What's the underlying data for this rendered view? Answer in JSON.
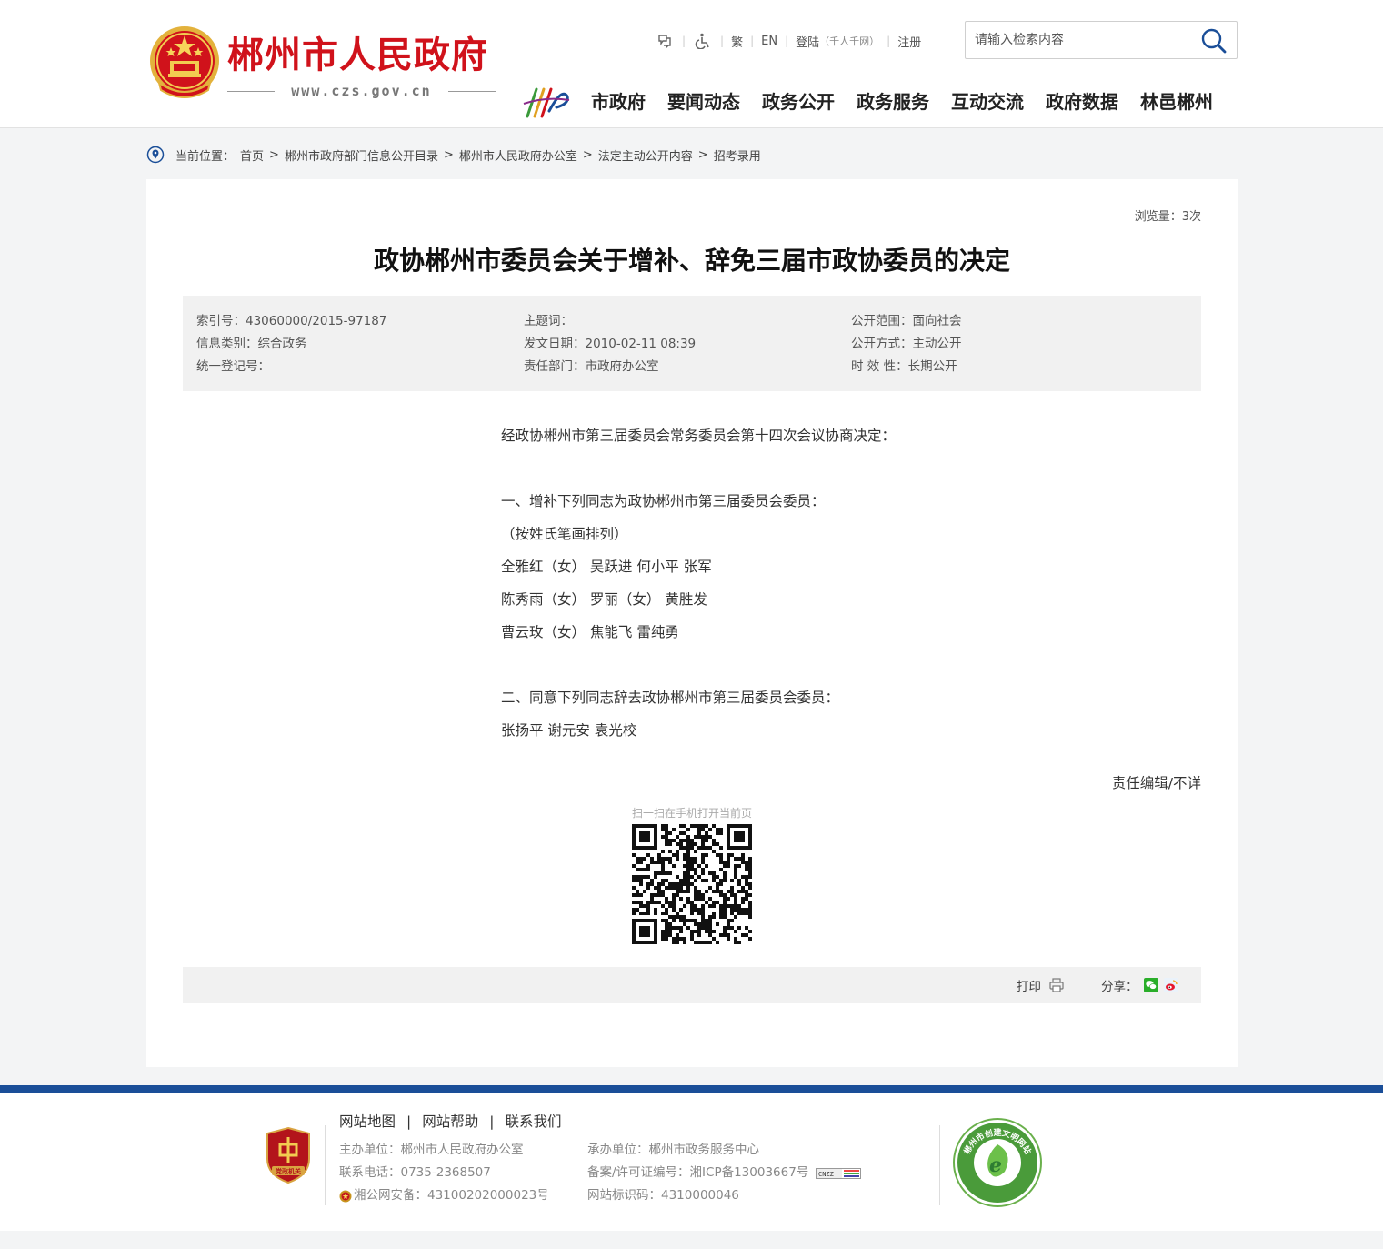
{
  "header": {
    "site_title": "郴州市人民政府",
    "site_url": "www.czs.gov.cn",
    "toplinks": {
      "traditional": "繁",
      "english": "EN",
      "login": "登陆",
      "login_note": "（千人千网）",
      "register": "注册"
    },
    "search_placeholder": "请输入检索内容",
    "nav": [
      "市政府",
      "要闻动态",
      "政务公开",
      "政务服务",
      "互动交流",
      "政府数据",
      "林邑郴州"
    ]
  },
  "breadcrumb": {
    "label": "当前位置：",
    "items": [
      "首页",
      "郴州市政府部门信息公开目录",
      "郴州市人民政府办公室",
      "法定主动公开内容",
      "招考录用"
    ]
  },
  "article": {
    "views": "浏览量：3次",
    "title": "政协郴州市委员会关于增补、辞免三届市政协委员的决定",
    "meta": {
      "index_no": "索引号：43060000/2015-97187",
      "subject": "主题词：",
      "scope": "公开范围：面向社会",
      "category": "信息类别：综合政务",
      "date": "发文日期：2010-02-11 08:39",
      "method": "公开方式：主动公开",
      "reg_no": "统一登记号：",
      "dept": "责任部门：市政府办公室",
      "validity": "时 效 性：长期公开"
    },
    "paragraphs": [
      "经政协郴州市第三届委员会常务委员会第十四次会议协商决定：",
      "",
      "一、增补下列同志为政协郴州市第三届委员会委员：",
      "（按姓氏笔画排列）",
      "全雅红（女）  吴跃进  何小平  张军",
      "陈秀雨（女）  罗丽（女）  黄胜发",
      "曹云玫（女）  焦能飞  雷纯勇",
      "",
      "二、同意下列同志辞去政协郴州市第三届委员会委员：",
      "张扬平  谢元安  袁光校"
    ],
    "editor": "责任编辑/不详",
    "qr_caption": "扫一扫在手机打开当前页",
    "print_label": "打印",
    "share_label": "分享："
  },
  "footer": {
    "links": [
      "网站地图",
      "网站帮助",
      "联系我们"
    ],
    "host": "主办单位：郴州市人民政府办公室",
    "phone": "联系电话：0735-2368507",
    "police": "湘公网安备：43100202000023号",
    "operator": "承办单位：郴州市政务服务中心",
    "icp": "备案/许可证编号：湘ICP备13003667号",
    "site_id": "网站标识码：4310000046",
    "party_badge": "党政机关",
    "civil_badge": "郴州市创建文明网站"
  },
  "colors": {
    "brand_red": "#d0121b",
    "footer_blue": "#1a4e98",
    "meta_bg": "#f1f1f1"
  }
}
